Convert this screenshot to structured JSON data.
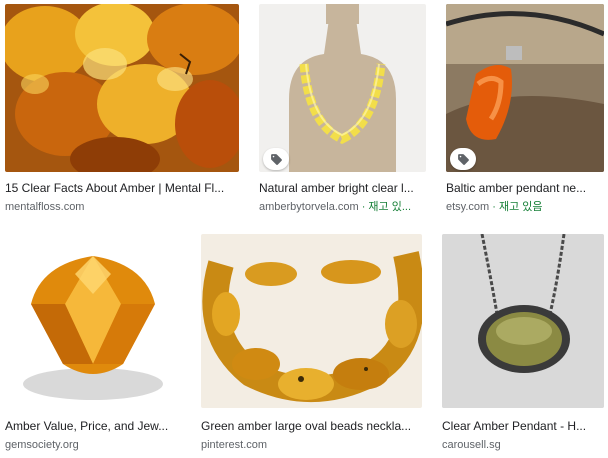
{
  "results": [
    {
      "title": "15 Clear Facts About Amber | Mental Fl...",
      "source": "mentalfloss.com",
      "stock": ""
    },
    {
      "title": "Natural amber bright clear l...",
      "source": "amberbytorvela.com",
      "stock": " · 재고 있..."
    },
    {
      "title": "Baltic amber pendant ne...",
      "source": "etsy.com",
      "stock": " · 재고 있음"
    },
    {
      "title": "Amber Value, Price, and Jew...",
      "source": "gemsociety.org",
      "stock": ""
    },
    {
      "title": "Green amber large oval beads neckla...",
      "source": "pinterest.com",
      "stock": ""
    },
    {
      "title": "Clear Amber Pendant - H...",
      "source": "carousell.sg",
      "stock": ""
    }
  ],
  "colors": {
    "stock_green": "#188038",
    "title": "#202124",
    "source": "#5f6368"
  },
  "icons": {
    "product_tag": "tag-icon"
  }
}
